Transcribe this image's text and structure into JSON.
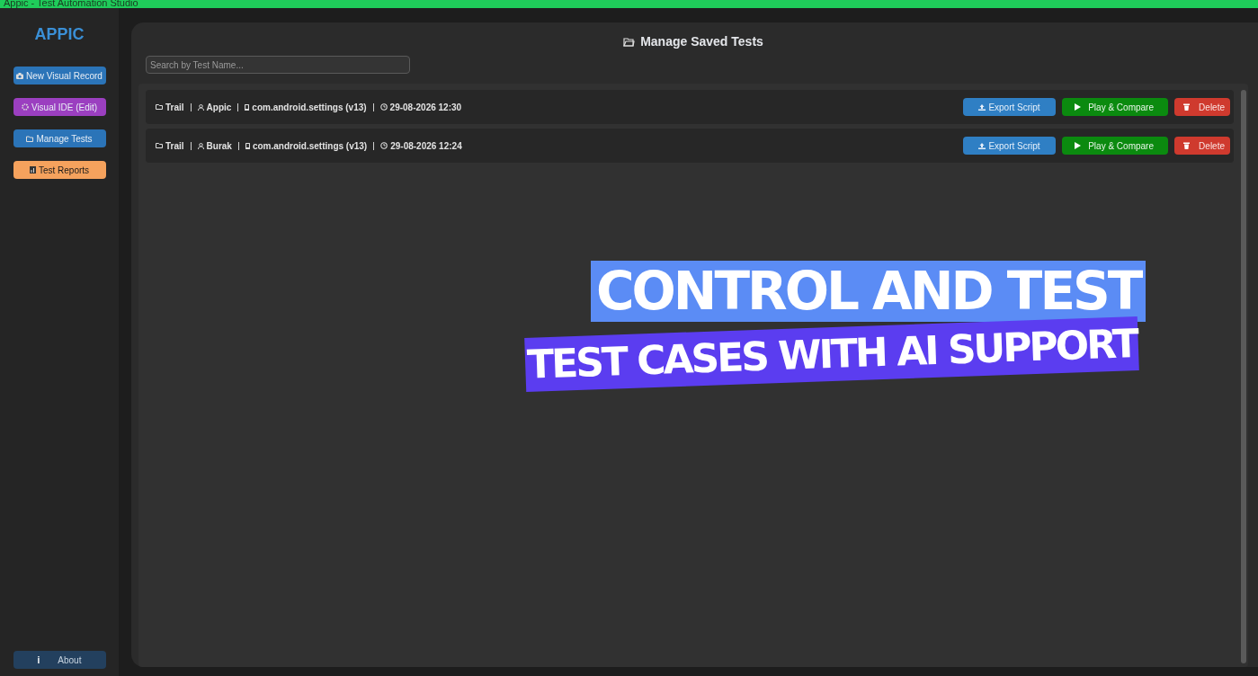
{
  "window": {
    "title": "Appic - Test Automation Studio"
  },
  "sidebar": {
    "logo": "APPIC",
    "items": [
      {
        "label": "New Visual Record",
        "color": "#2b74b8"
      },
      {
        "label": "Visual IDE (Edit)",
        "color": "#9b3fc0"
      },
      {
        "label": "Manage Tests",
        "color": "#2b74b8"
      },
      {
        "label": "Test Reports",
        "color": "#f5a25d"
      }
    ],
    "about": {
      "icon": "i",
      "label": "About"
    }
  },
  "main": {
    "title": "Manage Saved Tests",
    "search": {
      "placeholder": "Search by Test Name..."
    },
    "tests": [
      {
        "name": "Trail",
        "author": "Appic",
        "package": "com.android.settings (v13)",
        "date": "29-08-2026 12:30",
        "actions": [
          "Export Script",
          "Play & Compare",
          "Delete"
        ]
      },
      {
        "name": "Trail",
        "author": "Burak",
        "package": "com.android.settings (v13)",
        "date": "29-08-2026 12:24",
        "actions": [
          "Export Script",
          "Play & Compare",
          "Delete"
        ]
      }
    ]
  },
  "banner": {
    "lines": [
      {
        "text": "CONTROL AND TEST",
        "color": "#5b8cf5"
      },
      {
        "text": "TEST CASES WITH AI SUPPORT",
        "color": "#5b3df0"
      }
    ]
  }
}
